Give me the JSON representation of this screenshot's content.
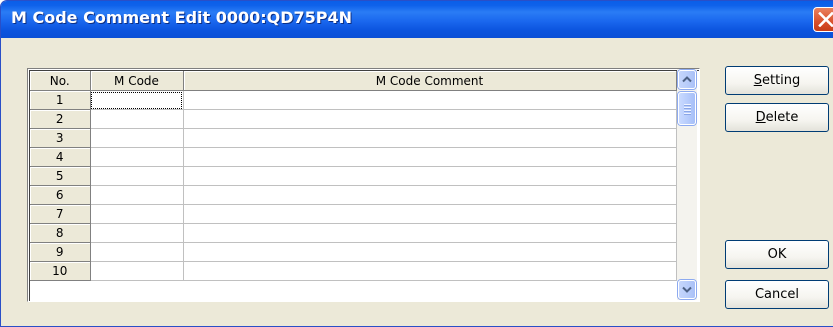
{
  "window": {
    "title": "M Code Comment Edit 0000:QD75P4N"
  },
  "grid": {
    "columns": [
      "No.",
      "M Code",
      "M Code Comment"
    ],
    "rows": [
      {
        "no": "1",
        "m_code": "",
        "comment": ""
      },
      {
        "no": "2",
        "m_code": "",
        "comment": ""
      },
      {
        "no": "3",
        "m_code": "",
        "comment": ""
      },
      {
        "no": "4",
        "m_code": "",
        "comment": ""
      },
      {
        "no": "5",
        "m_code": "",
        "comment": ""
      },
      {
        "no": "6",
        "m_code": "",
        "comment": ""
      },
      {
        "no": "7",
        "m_code": "",
        "comment": ""
      },
      {
        "no": "8",
        "m_code": "",
        "comment": ""
      },
      {
        "no": "9",
        "m_code": "",
        "comment": ""
      },
      {
        "no": "10",
        "m_code": "",
        "comment": ""
      }
    ]
  },
  "buttons": {
    "setting": "Setting",
    "delete": "Delete",
    "ok": "OK",
    "cancel": "Cancel"
  },
  "icons": {
    "close": "close-icon",
    "scroll_up": "arrow-up-icon",
    "scroll_down": "arrow-down-icon"
  },
  "colors": {
    "titlebar": "#0a5ee8",
    "close_button": "#d9502b",
    "dialog_background": "#ece9d8"
  }
}
